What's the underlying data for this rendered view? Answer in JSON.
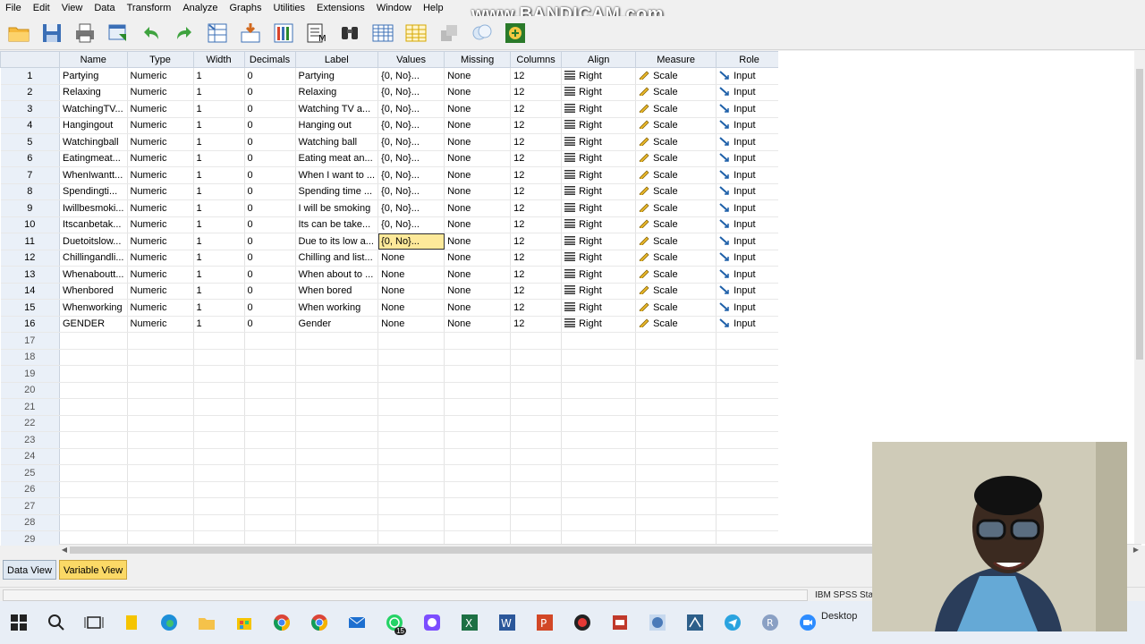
{
  "menu": [
    "File",
    "Edit",
    "View",
    "Data",
    "Transform",
    "Analyze",
    "Graphs",
    "Utilities",
    "Extensions",
    "Window",
    "Help"
  ],
  "watermark": "www.BANDICAM.com",
  "toolbar_icons": [
    "open-folder-icon",
    "save-icon",
    "print-icon",
    "recall-dialog-icon",
    "undo-icon",
    "redo-icon",
    "goto-case-icon",
    "goto-variable-icon",
    "variables-icon",
    "run-descriptives-icon",
    "find-icon",
    "split-file-icon",
    "select-cases-icon",
    "value-labels-icon",
    "use-sets-icon",
    "custom-icon"
  ],
  "columns": [
    "Name",
    "Type",
    "Width",
    "Decimals",
    "Label",
    "Values",
    "Missing",
    "Columns",
    "Align",
    "Measure",
    "Role"
  ],
  "rows": [
    {
      "num": "1",
      "name": "Partying",
      "type": "Numeric",
      "width": "1",
      "decimals": "0",
      "label": "Partying",
      "values": "{0, No}...",
      "missing": "None",
      "columns": "12",
      "align": "Right",
      "measure": "Scale",
      "role": "Input"
    },
    {
      "num": "2",
      "name": "Relaxing",
      "type": "Numeric",
      "width": "1",
      "decimals": "0",
      "label": "Relaxing",
      "values": "{0, No}...",
      "missing": "None",
      "columns": "12",
      "align": "Right",
      "measure": "Scale",
      "role": "Input"
    },
    {
      "num": "3",
      "name": "WatchingTV...",
      "type": "Numeric",
      "width": "1",
      "decimals": "0",
      "label": "Watching TV a...",
      "values": "{0, No}...",
      "missing": "None",
      "columns": "12",
      "align": "Right",
      "measure": "Scale",
      "role": "Input"
    },
    {
      "num": "4",
      "name": "Hangingout",
      "type": "Numeric",
      "width": "1",
      "decimals": "0",
      "label": "Hanging out",
      "values": "{0, No}...",
      "missing": "None",
      "columns": "12",
      "align": "Right",
      "measure": "Scale",
      "role": "Input"
    },
    {
      "num": "5",
      "name": "Watchingball",
      "type": "Numeric",
      "width": "1",
      "decimals": "0",
      "label": "Watching ball",
      "values": "{0, No}...",
      "missing": "None",
      "columns": "12",
      "align": "Right",
      "measure": "Scale",
      "role": "Input"
    },
    {
      "num": "6",
      "name": "Eatingmeat...",
      "type": "Numeric",
      "width": "1",
      "decimals": "0",
      "label": "Eating meat an...",
      "values": "{0, No}...",
      "missing": "None",
      "columns": "12",
      "align": "Right",
      "measure": "Scale",
      "role": "Input"
    },
    {
      "num": "7",
      "name": "WhenIwantt...",
      "type": "Numeric",
      "width": "1",
      "decimals": "0",
      "label": "When I want to ...",
      "values": "{0, No}...",
      "missing": "None",
      "columns": "12",
      "align": "Right",
      "measure": "Scale",
      "role": "Input"
    },
    {
      "num": "8",
      "name": "Spendingti...",
      "type": "Numeric",
      "width": "1",
      "decimals": "0",
      "label": "Spending time ...",
      "values": "{0, No}...",
      "missing": "None",
      "columns": "12",
      "align": "Right",
      "measure": "Scale",
      "role": "Input"
    },
    {
      "num": "9",
      "name": "Iwillbesmoki...",
      "type": "Numeric",
      "width": "1",
      "decimals": "0",
      "label": "I will be smoking",
      "values": "{0, No}...",
      "missing": "None",
      "columns": "12",
      "align": "Right",
      "measure": "Scale",
      "role": "Input"
    },
    {
      "num": "10",
      "name": "Itscanbetak...",
      "type": "Numeric",
      "width": "1",
      "decimals": "0",
      "label": "Its can be take...",
      "values": "{0, No}...",
      "missing": "None",
      "columns": "12",
      "align": "Right",
      "measure": "Scale",
      "role": "Input"
    },
    {
      "num": "11",
      "name": "Duetoitslow...",
      "type": "Numeric",
      "width": "1",
      "decimals": "0",
      "label": "Due to its low a...",
      "values": "{0, No}...",
      "missing": "None",
      "columns": "12",
      "align": "Right",
      "measure": "Scale",
      "role": "Input",
      "selected": true
    },
    {
      "num": "12",
      "name": "Chillingandli...",
      "type": "Numeric",
      "width": "1",
      "decimals": "0",
      "label": "Chilling and list...",
      "values": "None",
      "missing": "None",
      "columns": "12",
      "align": "Right",
      "measure": "Scale",
      "role": "Input"
    },
    {
      "num": "13",
      "name": "Whenaboutt...",
      "type": "Numeric",
      "width": "1",
      "decimals": "0",
      "label": "When about to ...",
      "values": "None",
      "missing": "None",
      "columns": "12",
      "align": "Right",
      "measure": "Scale",
      "role": "Input"
    },
    {
      "num": "14",
      "name": "Whenbored",
      "type": "Numeric",
      "width": "1",
      "decimals": "0",
      "label": "When bored",
      "values": "None",
      "missing": "None",
      "columns": "12",
      "align": "Right",
      "measure": "Scale",
      "role": "Input"
    },
    {
      "num": "15",
      "name": "Whenworking",
      "type": "Numeric",
      "width": "1",
      "decimals": "0",
      "label": "When working",
      "values": "None",
      "missing": "None",
      "columns": "12",
      "align": "Right",
      "measure": "Scale",
      "role": "Input"
    },
    {
      "num": "16",
      "name": "GENDER",
      "type": "Numeric",
      "width": "1",
      "decimals": "0",
      "label": "Gender",
      "values": "None",
      "missing": "None",
      "columns": "12",
      "align": "Right",
      "measure": "Scale",
      "role": "Input"
    }
  ],
  "empty_rows": [
    "17",
    "18",
    "19",
    "20",
    "21",
    "22",
    "23",
    "24",
    "25",
    "26",
    "27",
    "28",
    "29"
  ],
  "tabs": {
    "data_view": "Data View",
    "variable_view": "Variable View"
  },
  "status": {
    "processor": "IBM SPSS Sta"
  },
  "taskbar": {
    "icons": [
      "windows-start-icon",
      "search-icon",
      "task-view-icon",
      "file-icon",
      "edge-icon",
      "file-explorer-icon",
      "store-icon",
      "chrome-icon",
      "chrome-icon",
      "mail-icon",
      "whatsapp-icon",
      "app-icon",
      "excel-icon",
      "word-icon",
      "powerpoint-icon",
      "record-icon",
      "bandicam-icon",
      "spss-icon",
      "network-icon",
      "telegram-icon",
      "r-icon",
      "zoom-icon"
    ],
    "whatsapp_badge": "15",
    "desktop_label": "Desktop"
  },
  "colors": {
    "selected_cell": "#fde99a",
    "active_tab": "#fbd966",
    "header_bg": "#e9eef5",
    "rownum_bg": "#eaf0f8"
  }
}
